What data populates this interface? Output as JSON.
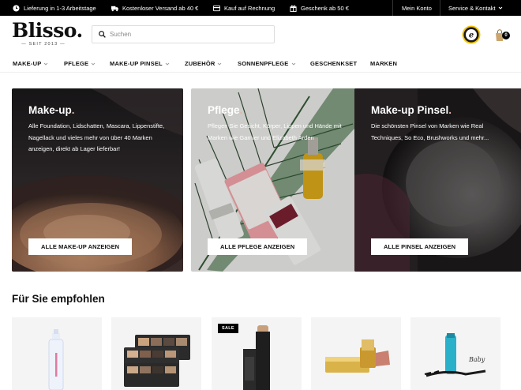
{
  "topbar": {
    "usps": [
      {
        "icon": "clock-icon",
        "label": "Lieferung in 1-3 Arbeitstage"
      },
      {
        "icon": "truck-icon",
        "label": "Kostenloser Versand ab 40 €"
      },
      {
        "icon": "invoice-icon",
        "label": "Kauf auf Rechnung"
      },
      {
        "icon": "gift-icon",
        "label": "Geschenk ab 50 €"
      }
    ],
    "account_label": "Mein Konto",
    "service_label": "Service & Kontakt"
  },
  "header": {
    "logo_text": "Blisso.",
    "logo_since": "— SEIT 2013 —",
    "search_placeholder": "Suchen",
    "cart_count": "0"
  },
  "nav": {
    "items": [
      {
        "label": "MAKE-UP",
        "dropdown": true
      },
      {
        "label": "PFLEGE",
        "dropdown": true
      },
      {
        "label": "MAKE-UP PINSEL",
        "dropdown": true
      },
      {
        "label": "ZUBEHÖR",
        "dropdown": true
      },
      {
        "label": "SONNENPFLEGE",
        "dropdown": true
      },
      {
        "label": "GESCHENKSET",
        "dropdown": false
      },
      {
        "label": "MARKEN",
        "dropdown": false
      }
    ]
  },
  "categories": [
    {
      "title": "Make-up",
      "title_dot": ".",
      "description": "Alle Foundation, Lidschatten, Mascara, Lippenstifte, Nagellack und vieles mehr von über 40 Marken anzeigen, direkt ab Lager lieferbar!",
      "button": "ALLE MAKE-UP ANZEIGEN"
    },
    {
      "title": "Pflege",
      "title_dot": ".",
      "description": "Pflegen Sie Gesicht, Körper, Lippen und Hände mit Marken wie Garnier und Elizabeth Arden",
      "button": "ALLE PFLEGE ANZEIGEN"
    },
    {
      "title": "Make-up Pinsel",
      "title_dot": ".",
      "description": "Die schönsten Pinsel von Marken wie Real Techniques, So Eco, Brushworks und mehr...",
      "button": "ALLE PINSEL ANZEIGEN"
    }
  ],
  "recommended": {
    "title": "Für Sie empfohlen",
    "sale_badge": "SALE",
    "products": [
      {
        "image": "spray-bottle"
      },
      {
        "image": "eyeshadow-palettes"
      },
      {
        "image": "foundation-stick",
        "sale": true
      },
      {
        "image": "lipstick"
      },
      {
        "image": "mascara"
      }
    ]
  },
  "colors": {
    "topbar_bg": "#000000",
    "accent_dot": "#e2b5a3",
    "card_button_bg": "#ffffff",
    "product_tile_bg": "#f4f4f4"
  }
}
